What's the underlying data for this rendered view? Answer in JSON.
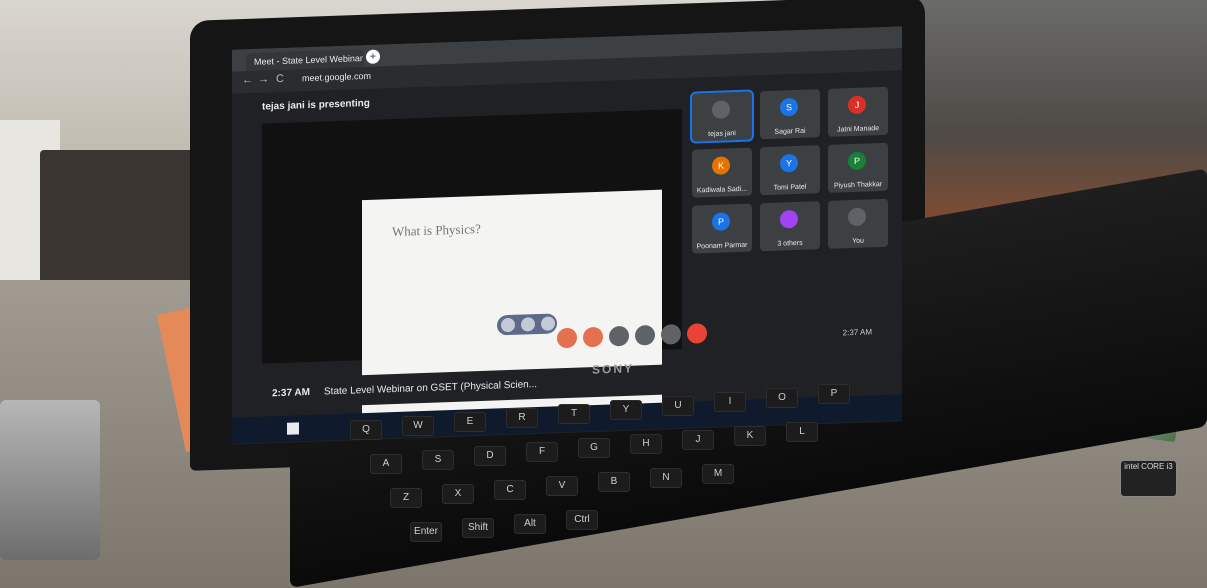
{
  "browser": {
    "tab_title": "Meet - State Level Webinar",
    "new_tab_symbol": "+",
    "url": "meet.google.com",
    "nav_back": "←",
    "nav_forward": "→",
    "nav_reload": "C"
  },
  "meet": {
    "presenting_text": "tejas jani is presenting",
    "slide_title": "What is Physics?",
    "participants": [
      {
        "name": "tejas jani",
        "initial": "",
        "color": "#5f6368",
        "active": true
      },
      {
        "name": "Sagar Rai",
        "initial": "S",
        "color": "#1a73e8",
        "active": false
      },
      {
        "name": "Jatni Manade",
        "initial": "J",
        "color": "#d93025",
        "active": false
      },
      {
        "name": "Kadiwala Sadi...",
        "initial": "K",
        "color": "#e37400",
        "active": false
      },
      {
        "name": "Tomi Patel",
        "initial": "Y",
        "color": "#1a73e8",
        "active": false
      },
      {
        "name": "Piyush Thakkar",
        "initial": "P",
        "color": "#188038",
        "active": false
      },
      {
        "name": "Poonam Parmar",
        "initial": "P",
        "color": "#1a73e8",
        "active": false
      },
      {
        "name": "3 others",
        "initial": "",
        "color": "#a142f4",
        "active": false
      },
      {
        "name": "You",
        "initial": "",
        "color": "#5f6368",
        "active": false
      }
    ],
    "bottom_time": "2:37 AM",
    "meeting_title": "State Level Webinar on GSET (Physical Scien..."
  },
  "taskbar": {
    "sys_time": "2:37 AM"
  },
  "laptop": {
    "brand": "SONY",
    "sticker": "intel CORE i3"
  },
  "keyboard": {
    "keys": [
      "Q",
      "W",
      "E",
      "R",
      "T",
      "Y",
      "U",
      "I",
      "O",
      "P",
      "A",
      "S",
      "D",
      "F",
      "G",
      "H",
      "J",
      "K",
      "L",
      "Z",
      "X",
      "C",
      "V",
      "B",
      "N",
      "M",
      "Enter",
      "Shift",
      "Alt",
      "Ctrl"
    ]
  }
}
